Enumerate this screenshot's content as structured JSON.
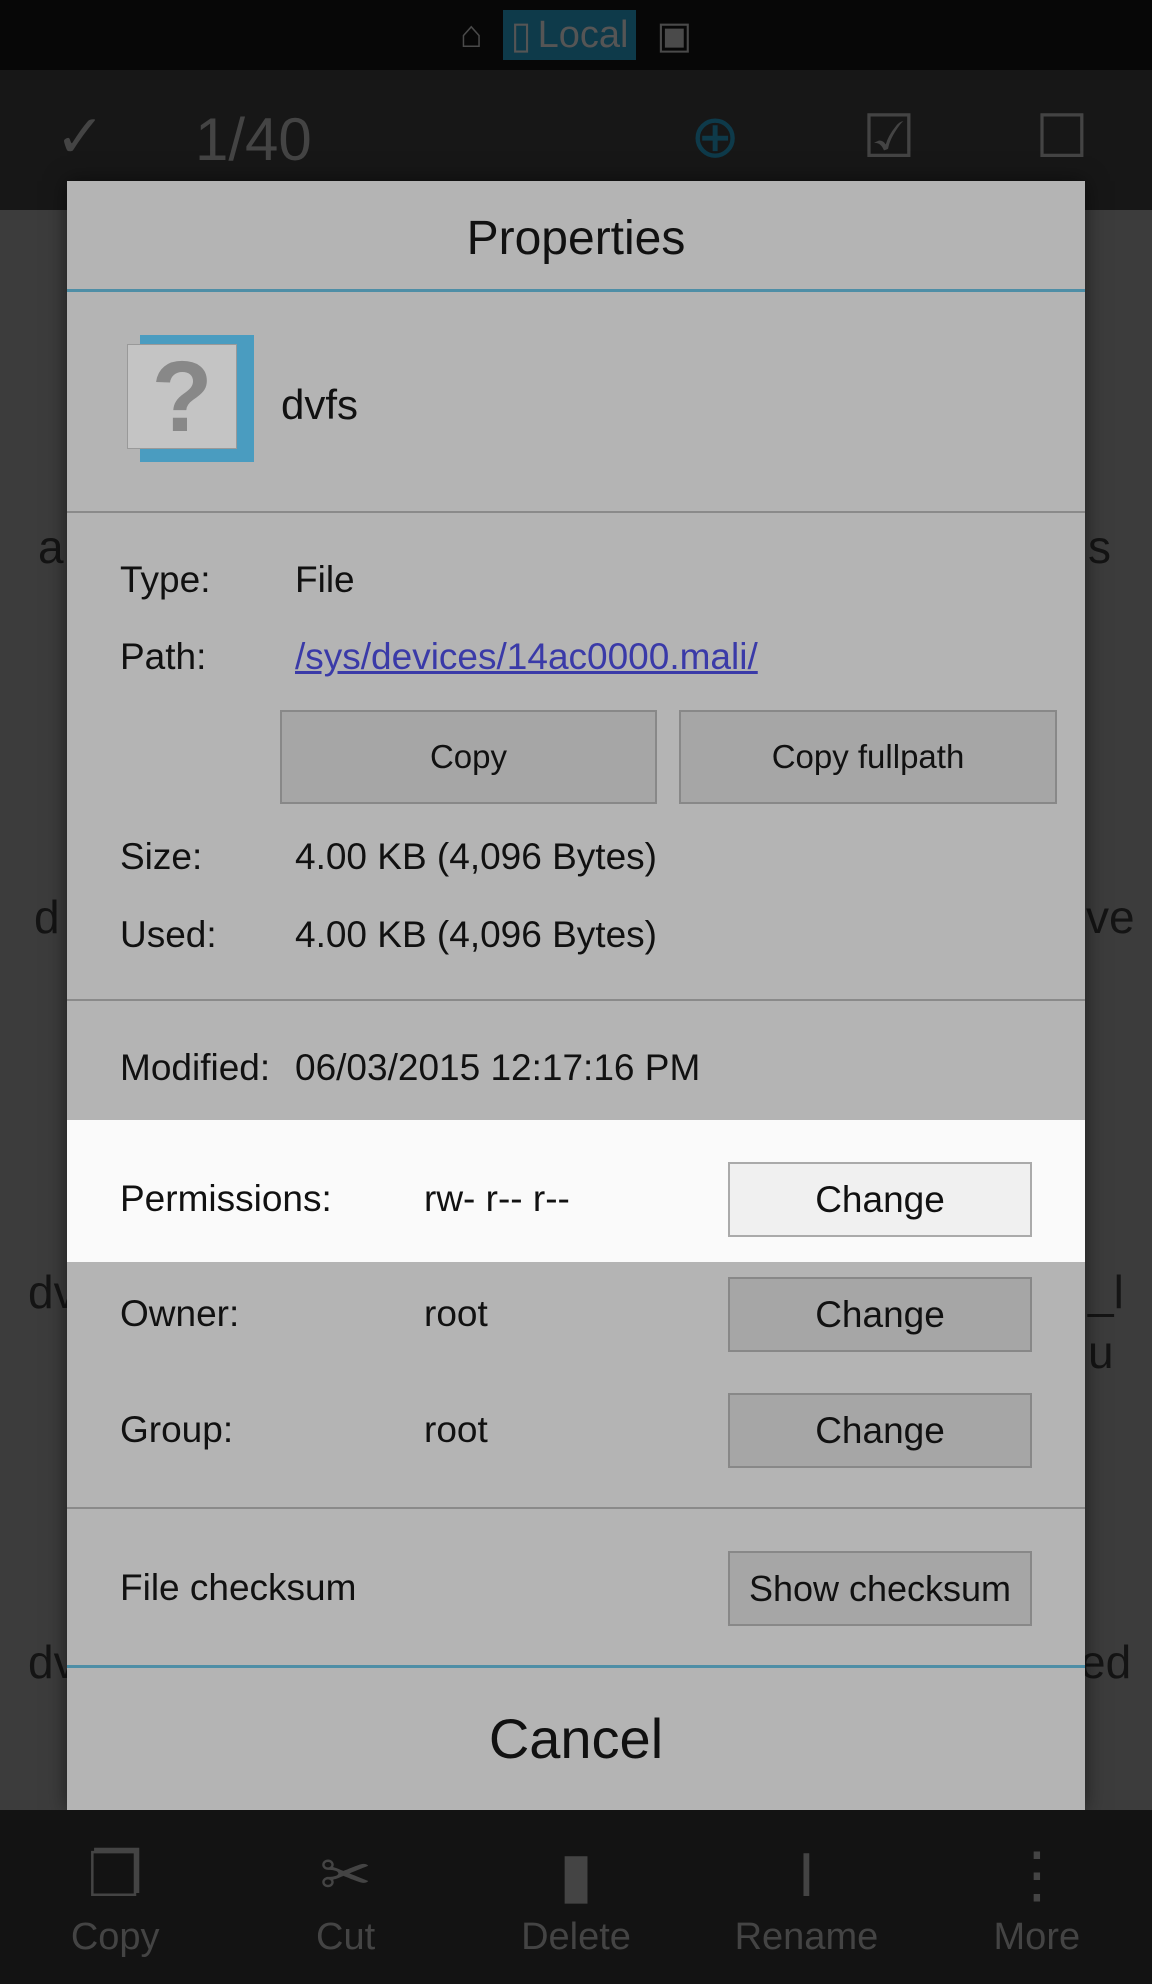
{
  "topbar": {
    "home_icon": "home-icon",
    "local_label": "Local",
    "devices_icon": "devices-icon",
    "accent": "#0e3a4a"
  },
  "toolbar": {
    "selection_count": "1/40"
  },
  "background_fragments": [
    "a",
    "s",
    "d",
    "ve",
    "dv",
    "_l",
    "u",
    "dv",
    "ed"
  ],
  "dialog": {
    "title": "Properties",
    "file_name": "dvfs",
    "type_label": "Type:",
    "type_value": "File",
    "path_label": "Path:",
    "path_value": "/sys/devices/14ac0000.mali/",
    "copy_button": "Copy",
    "copy_fullpath_button": "Copy fullpath",
    "size_label": "Size:",
    "size_value": "4.00 KB (4,096 Bytes)",
    "used_label": "Used:",
    "used_value": "4.00 KB (4,096 Bytes)",
    "modified_label": "Modified:",
    "modified_value": "06/03/2015 12:17:16 PM",
    "permissions_label": "Permissions:",
    "permissions_value": "rw- r-- r--",
    "owner_label": "Owner:",
    "owner_value": "root",
    "group_label": "Group:",
    "group_value": "root",
    "change_button": "Change",
    "checksum_label": "File checksum",
    "show_checksum_button": "Show checksum",
    "cancel_button": "Cancel",
    "link_color": "#3a3aa8",
    "divider_accent": "#4e8ea6"
  },
  "bottombar": {
    "items": [
      {
        "label": "Copy",
        "icon": "copy-icon"
      },
      {
        "label": "Cut",
        "icon": "scissors-icon"
      },
      {
        "label": "Delete",
        "icon": "trash-icon"
      },
      {
        "label": "Rename",
        "icon": "text-cursor-icon"
      },
      {
        "label": "More",
        "icon": "more-vertical-icon"
      }
    ]
  }
}
